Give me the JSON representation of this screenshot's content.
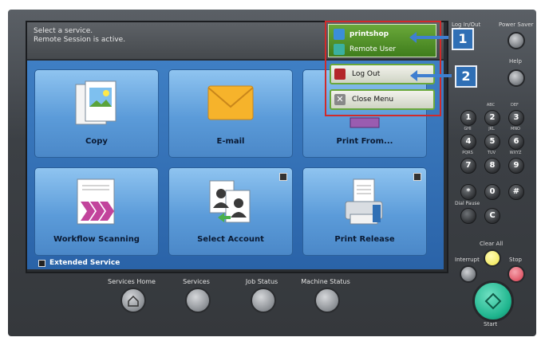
{
  "status": {
    "line1": "Select a service.",
    "line2": "Remote Session is active."
  },
  "tiles": [
    {
      "label": "Copy"
    },
    {
      "label": "E-mail"
    },
    {
      "label": "Print From..."
    },
    {
      "label": "Workflow Scanning"
    },
    {
      "label": "Select Account"
    },
    {
      "label": "Print Release"
    }
  ],
  "extended_service": "Extended Service",
  "popup": {
    "user": "printshop",
    "user_type": "Remote User",
    "logout_label": "Log Out",
    "close_label": "Close Menu"
  },
  "callouts": [
    "1",
    "2"
  ],
  "bottom_buttons": [
    "Services Home",
    "Services",
    "Job Status",
    "Machine Status"
  ],
  "right_panel": {
    "login_label": "Log In/Out",
    "power_label": "Power Saver",
    "help_label": "Help",
    "clear_all_label": "Clear All",
    "interrupt_label": "Interrupt",
    "stop_label": "Stop",
    "start_label": "Start",
    "dial_pause_label": "Dial Pause"
  },
  "keypad": [
    {
      "key": "1",
      "sub": ""
    },
    {
      "key": "2",
      "sub": "ABC"
    },
    {
      "key": "3",
      "sub": "DEF"
    },
    {
      "key": "4",
      "sub": "GHI"
    },
    {
      "key": "5",
      "sub": "JKL"
    },
    {
      "key": "6",
      "sub": "MNO"
    },
    {
      "key": "7",
      "sub": "PQRS"
    },
    {
      "key": "8",
      "sub": "TUV"
    },
    {
      "key": "9",
      "sub": "WXYZ"
    },
    {
      "key": "*",
      "sub": ""
    },
    {
      "key": "0",
      "sub": ""
    },
    {
      "key": "#",
      "sub": ""
    },
    {
      "key": "C",
      "sub": ""
    }
  ],
  "colors": {
    "accent_blue": "#2f6fb5",
    "popup_green": "#4f8f2a",
    "highlight_red": "#d02a2a",
    "start_green": "#1fb58e",
    "clear_yellow": "#f4ec6a",
    "stop_red": "#e05a6a"
  }
}
